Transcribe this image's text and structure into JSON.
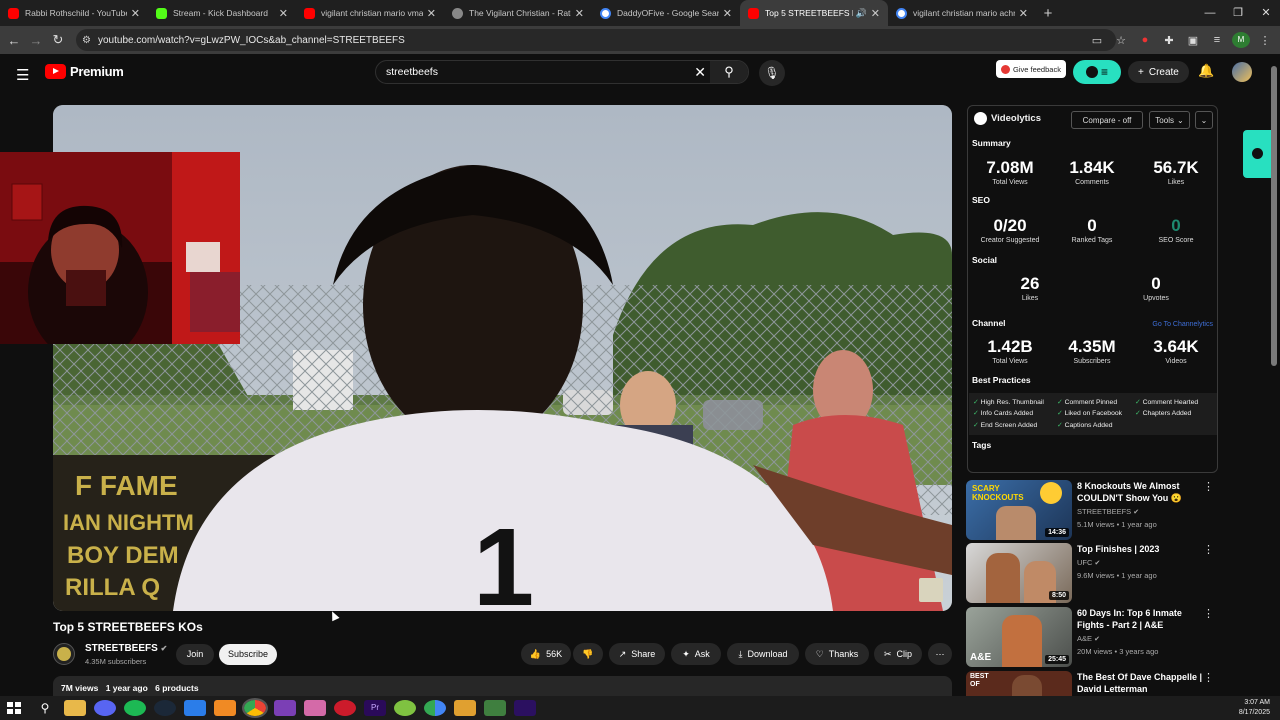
{
  "browser": {
    "tabs": [
      {
        "title": "Rabbi Rothschild - YouTube",
        "color": "#ff0000"
      },
      {
        "title": "Stream - Kick Dashboard",
        "color": "#53fc18"
      },
      {
        "title": "vigilant christian mario vma - Y",
        "color": "#ff0000"
      },
      {
        "title": "The Vigilant Christian - Rationa",
        "color": "#888888"
      },
      {
        "title": "DaddyOFive - Google Search",
        "color": "#4285f4"
      },
      {
        "title": "Top 5 STREETBEEFS KOs - Y",
        "color": "#ff0000"
      },
      {
        "title": "vigilant christian mario achrive",
        "color": "#4285f4"
      }
    ],
    "url": "youtube.com/watch?v=gLwzPW_IOCs&ab_channel=STREETBEEFS"
  },
  "youtube": {
    "logo_text": "Premium",
    "search_value": "streetbeefs",
    "feedback_label": "Give feedback",
    "create_label": "Create"
  },
  "video": {
    "title": "Top 5 STREETBEEFS KOs",
    "channel": "STREETBEEFS",
    "subscribers": "4.35M subscribers",
    "join_label": "Join",
    "subscribe_label": "Subscribe",
    "likes": "56K",
    "share_label": "Share",
    "ask_label": "Ask",
    "download_label": "Download",
    "thanks_label": "Thanks",
    "clip_label": "Clip",
    "views": "7M views",
    "age": "1 year ago",
    "products": "6 products",
    "overlay_text": [
      "F FAME",
      "IAN NIGHTM",
      "BOY DEM",
      "RILLA Q"
    ],
    "jersey_number": "1"
  },
  "videolytics": {
    "brand": "Videolytics",
    "compare_label": "Compare - off",
    "tools_label": "Tools",
    "summary_heading": "Summary",
    "summary": [
      {
        "value": "7.08M",
        "label": "Total Views"
      },
      {
        "value": "1.84K",
        "label": "Comments"
      },
      {
        "value": "56.7K",
        "label": "Likes"
      }
    ],
    "seo_heading": "SEO",
    "seo": [
      {
        "value": "0/20",
        "label": "Creator Suggested"
      },
      {
        "value": "0",
        "label": "Ranked Tags"
      },
      {
        "value": "0",
        "label": "SEO Score"
      }
    ],
    "social_heading": "Social",
    "social": [
      {
        "value": "26",
        "label": "Likes"
      },
      {
        "value": "0",
        "label": "Upvotes"
      }
    ],
    "channel_heading": "Channel",
    "channel_link": "Go To Channelytics",
    "channel": [
      {
        "value": "1.42B",
        "label": "Total Views"
      },
      {
        "value": "4.35M",
        "label": "Subscribers"
      },
      {
        "value": "3.64K",
        "label": "Videos"
      }
    ],
    "best_practices_heading": "Best Practices",
    "best_practices": [
      "High Res. Thumbnail",
      "Comment Pinned",
      "Comment Hearted",
      "Info Cards Added",
      "Liked on Facebook",
      "Chapters Added",
      "End Screen Added",
      "Captions Added"
    ],
    "tags_heading": "Tags"
  },
  "recommendations": [
    {
      "title": "8 Knockouts We Almost COULDN'T Show You 😮",
      "channel": "STREETBEEFS",
      "meta": "5.1M views • 1 year ago",
      "duration": "14:36",
      "thumb_text": "SCARY KNOCKOUTS"
    },
    {
      "title": "Top Finishes | 2023",
      "channel": "UFC",
      "meta": "9.6M views • 1 year ago",
      "duration": "8:50",
      "thumb_text": ""
    },
    {
      "title": "60 Days In: Top 6 Inmate Fights - Part 2 | A&E",
      "channel": "A&E",
      "meta": "20M views • 3 years ago",
      "duration": "25:45",
      "thumb_text": "A&E"
    },
    {
      "title": "The Best Of Dave Chappelle | David Letterman",
      "channel": "",
      "meta": "",
      "duration": "",
      "thumb_text": "BEST OF"
    }
  ],
  "taskbar": {
    "time": "3:07 AM",
    "date": "8/17/2025"
  }
}
